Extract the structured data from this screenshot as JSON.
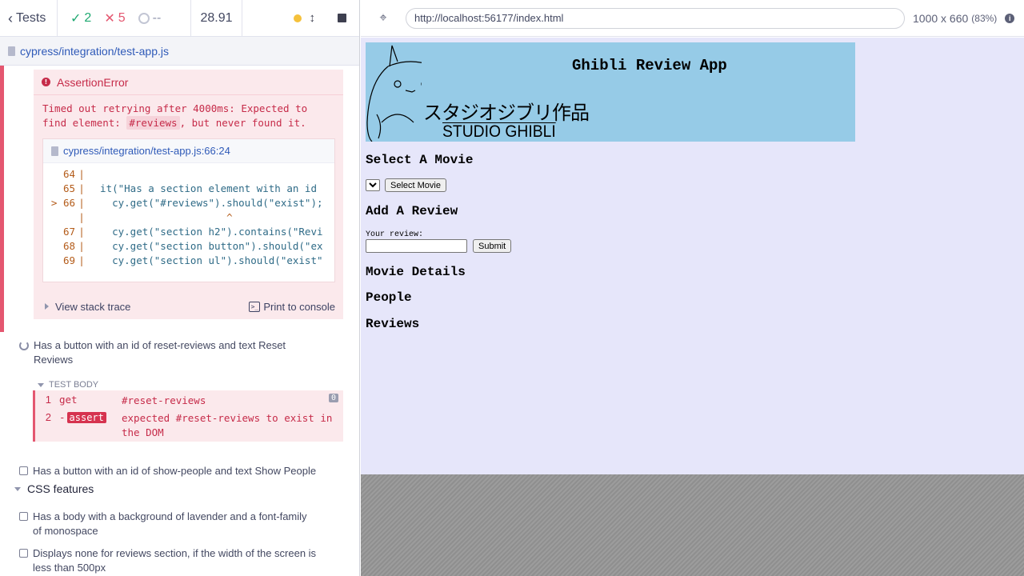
{
  "reporter": {
    "stats": {
      "tests_label": "Tests",
      "passed": "2",
      "failed": "5",
      "pending": "--",
      "duration": "28.91"
    },
    "spec_file": "cypress/integration/test-app.js",
    "error": {
      "type": "AssertionError",
      "message_prefix": "Timed out retrying after 4000ms: Expected to find element: ",
      "selector": "#reviews",
      "message_suffix": ", but never found it.",
      "frame_file": "cypress/integration/test-app.js:66:24",
      "code_lines": [
        {
          "num": "64",
          "marker": "",
          "text": ""
        },
        {
          "num": "65",
          "marker": "",
          "text": "  it(\"Has a section element with an id"
        },
        {
          "num": "66",
          "marker": ">",
          "text": "    cy.get(\"#reviews\").should(\"exist\");"
        },
        {
          "num": "",
          "marker": "",
          "text": "                       ^"
        },
        {
          "num": "67",
          "marker": "",
          "text": "    cy.get(\"section h2\").contains(\"Revi"
        },
        {
          "num": "68",
          "marker": "",
          "text": "    cy.get(\"section button\").should(\"ex"
        },
        {
          "num": "69",
          "marker": "",
          "text": "    cy.get(\"section ul\").should(\"exist\""
        }
      ],
      "view_stack_trace": "View stack trace",
      "print_to_console": "Print to console"
    },
    "tests": [
      "Has a button with an id of reset-reviews and text Reset Reviews",
      "Has a button with an id of show-people and text Show People"
    ],
    "test_body_label": "TEST BODY",
    "commands": [
      {
        "num": "1",
        "name": "get",
        "message": "#reset-reviews",
        "count": "0"
      },
      {
        "num": "2",
        "name": "assert",
        "message": "expected #reset-reviews to exist in the DOM"
      }
    ],
    "suite": "CSS features",
    "suite_tests": [
      "Has a body with a background of lavender and a font-family of monospace",
      "Displays none for reviews section, if the width of the screen is less than 500px"
    ]
  },
  "aut": {
    "url": "http://localhost:56177/index.html",
    "viewport": "1000 x 660",
    "scale": "(83%)",
    "banner_title": "Ghibli Review App",
    "banner_jp": "スタジオジブリ作品",
    "banner_en": "STUDIO GHIBLI",
    "select_heading": "Select A Movie",
    "select_button": "Select Movie",
    "review_heading": "Add A Review",
    "review_label": "Your review:",
    "submit_button": "Submit",
    "details_heading": "Movie Details",
    "people_heading": "People",
    "reviews_heading": "Reviews"
  },
  "colors": {
    "pass": "#1fa971",
    "fail": "#e45770",
    "aut_background": "#e6e6fa",
    "banner": "#96cbe7"
  }
}
